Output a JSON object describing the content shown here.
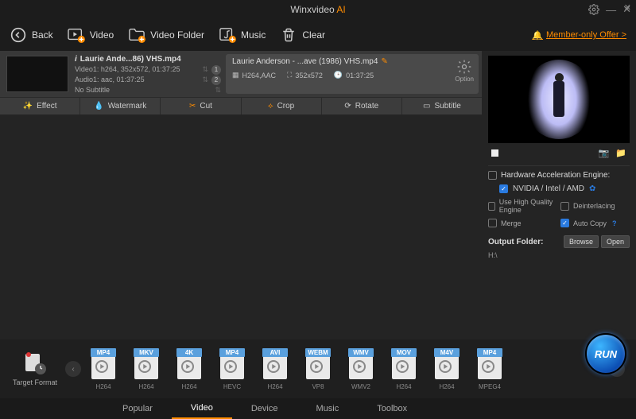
{
  "app": {
    "title": "Winxvideo",
    "title_suffix": "AI"
  },
  "toolbar": {
    "back": "Back",
    "video": "Video",
    "video_folder": "Video Folder",
    "music": "Music",
    "clear": "Clear",
    "member_offer": "Member-only Offer >"
  },
  "item": {
    "name_short": "Laurie Ande...86) VHS.mp4",
    "name_full": "Laurie Anderson - ...ave (1986) VHS.mp4",
    "video_line": "Video1: h264, 352x572, 01:37:25",
    "audio_line": "Audio1: aac, 01:37:25",
    "subtitle_line": "No Subtitle",
    "badges": [
      "1",
      "2"
    ],
    "codec": "H264,AAC",
    "resolution": "352x572",
    "duration": "01:37:25",
    "option_label": "Option"
  },
  "editbar": {
    "effect": "Effect",
    "watermark": "Watermark",
    "cut": "Cut",
    "crop": "Crop",
    "rotate": "Rotate",
    "subtitle": "Subtitle"
  },
  "options": {
    "hw_engine_label": "Hardware Acceleration Engine:",
    "gpu_label": "NVIDIA / Intel / AMD",
    "hq_label": "Use High Quality Engine",
    "deint_label": "Deinterlacing",
    "merge_label": "Merge",
    "autocopy_label": "Auto Copy",
    "gpu_checked": true,
    "hq_checked": false,
    "deint_checked": false,
    "merge_checked": false,
    "autocopy_checked": true
  },
  "output": {
    "label": "Output Folder:",
    "path": "H:\\",
    "browse": "Browse",
    "open": "Open"
  },
  "target_format_label": "Target Format",
  "formats": [
    {
      "badge": "MP4",
      "label": "H264"
    },
    {
      "badge": "MKV",
      "label": "H264"
    },
    {
      "badge": "4K",
      "label": "H264"
    },
    {
      "badge": "MP4",
      "label": "HEVC"
    },
    {
      "badge": "AVI",
      "label": "H264"
    },
    {
      "badge": "WEBM",
      "label": "VP8"
    },
    {
      "badge": "WMV",
      "label": "WMV2"
    },
    {
      "badge": "MOV",
      "label": "H264"
    },
    {
      "badge": "M4V",
      "label": "H264"
    },
    {
      "badge": "MP4",
      "label": "MPEG4"
    }
  ],
  "tabs": {
    "items": [
      "Popular",
      "Video",
      "Device",
      "Music",
      "Toolbox"
    ],
    "active": 1
  },
  "run_label": "RUN"
}
